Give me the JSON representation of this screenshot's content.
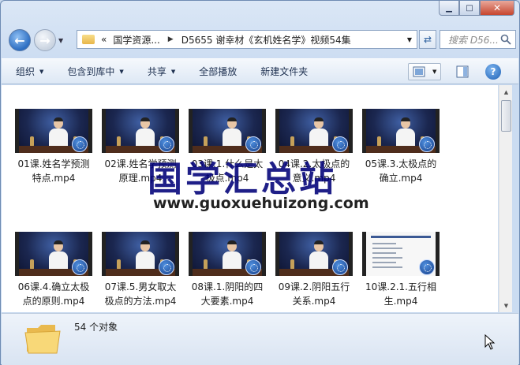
{
  "window": {
    "caption": {
      "min": "▁",
      "max": "□",
      "close": "✕"
    }
  },
  "nav": {
    "back_glyph": "←",
    "forward_glyph": "→",
    "address": {
      "overflow": "«",
      "crumbs": [
        "国学资源...",
        "D5655 谢幸材《玄机姓名学》视频54集"
      ]
    },
    "search_placeholder": "搜索 D56..."
  },
  "toolbar": {
    "items": [
      {
        "label": "组织",
        "dropdown": true
      },
      {
        "label": "包含到库中",
        "dropdown": true
      },
      {
        "label": "共享",
        "dropdown": true
      },
      {
        "label": "全部播放",
        "dropdown": false
      },
      {
        "label": "新建文件夹",
        "dropdown": false
      }
    ],
    "help_glyph": "?"
  },
  "files": [
    {
      "name": "01课.姓名学预测特点.mp4",
      "thumb": "lecture"
    },
    {
      "name": "02课.姓名学预测原理.mp4",
      "thumb": "lecture"
    },
    {
      "name": "03课.1.什么是太极点.mp4",
      "thumb": "lecture"
    },
    {
      "name": "04课.2.太极点的意义.mp4",
      "thumb": "lecture"
    },
    {
      "name": "05课.3.太极点的确立.mp4",
      "thumb": "lecture"
    },
    {
      "name": "06课.4.确立太极点的原则.mp4",
      "thumb": "lecture"
    },
    {
      "name": "07课.5.男女取太极点的方法.mp4",
      "thumb": "lecture"
    },
    {
      "name": "08课.1.阴阳的四大要素.mp4",
      "thumb": "lecture"
    },
    {
      "name": "09课.2.阴阳五行关系.mp4",
      "thumb": "lecture"
    },
    {
      "name": "10课.2.1.五行相生.mp4",
      "thumb": "document"
    }
  ],
  "watermark": {
    "text": "国学汇总站",
    "url": "www.guoxuehuizong.com"
  },
  "status": {
    "count_text": "54 个对象"
  }
}
